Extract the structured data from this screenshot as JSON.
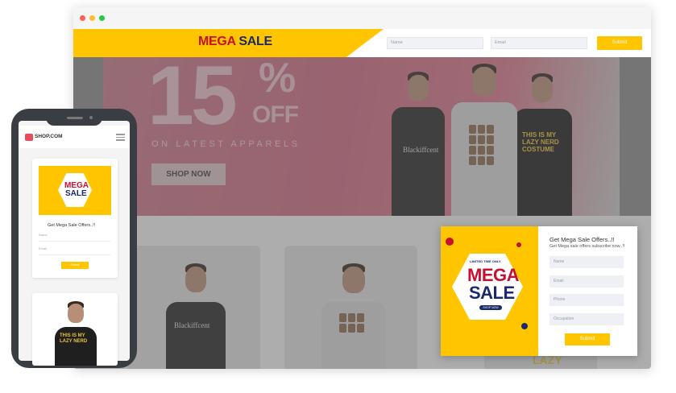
{
  "browser": {
    "window_buttons": [
      "close",
      "minimize",
      "maximize"
    ],
    "colors": {
      "close": "#fe5f57",
      "minimize": "#febc2e",
      "maximize": "#28c840",
      "accent": "#ffc600"
    }
  },
  "topbar": {
    "logo_mega": "MEGA",
    "logo_sale": "SALE",
    "name_placeholder": "Name",
    "email_placeholder": "Email",
    "submit_label": "Submit"
  },
  "hero": {
    "big_number": "15",
    "percent": "%",
    "off": "OFF",
    "tagline": "ON LATEST APPARELS",
    "shop_now": "SHOP NOW",
    "tshirt_left_text": "Blackiffcent",
    "tshirt_right_text": "THIS IS MY LAZY NERD COSTUME"
  },
  "popup": {
    "badge_top": "LIMITED TIME ONLY",
    "badge_mega": "MEGA",
    "badge_sale": "SALE",
    "badge_bottom": "SHOP NOW",
    "title": "Get Mega Sale Offers..!!",
    "subtitle": "Get Mega sale offers subscribe now..!!",
    "fields": [
      "Name",
      "Email",
      "Phone",
      "Occupation"
    ],
    "submit_label": "Submit"
  },
  "products": {
    "card1_text": "Blackiffcent",
    "card2_text": "LAZY"
  },
  "mobile": {
    "brand": "SHOP.COM",
    "badge_mega": "MEGA",
    "badge_sale": "SALE",
    "title": "Get Mega Sale Offers..!!",
    "fields": [
      "Name",
      "Email"
    ],
    "submit_label": "Submit",
    "shirt_text": "THIS IS MY LAZY NERD"
  }
}
